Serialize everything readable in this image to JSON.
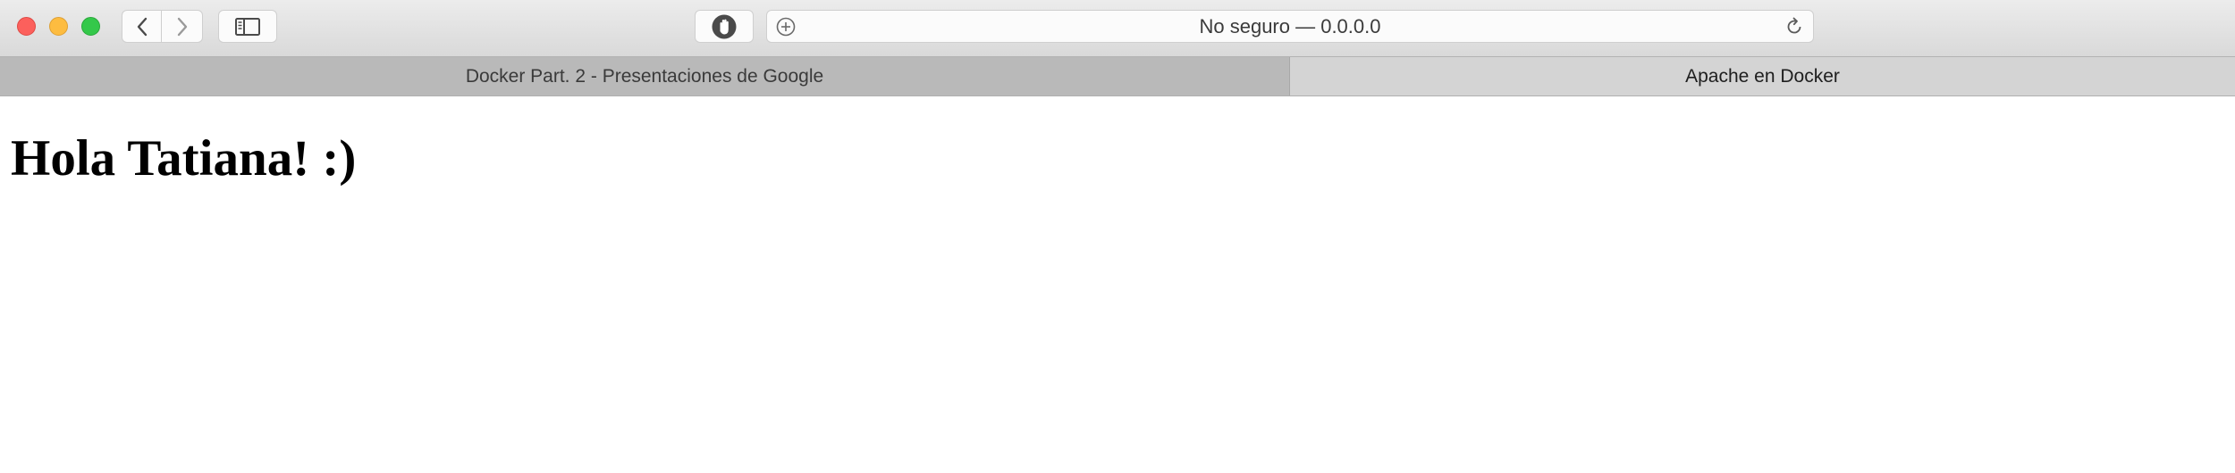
{
  "window": {
    "traffic_lights": {
      "close_color": "#fc605c",
      "minimize_color": "#fdbc40",
      "zoom_color": "#34c84a"
    }
  },
  "toolbar": {
    "icons": {
      "back": "chevron-left-icon",
      "forward": "chevron-right-icon",
      "sidebar": "sidebar-icon",
      "content_blocker": "hand-icon",
      "add": "plus-circle-icon",
      "reload": "reload-icon"
    },
    "address_text": "No seguro — 0.0.0.0"
  },
  "tabs": [
    {
      "label": "Docker Part. 2 - Presentaciones de Google",
      "active": false
    },
    {
      "label": "Apache en Docker",
      "active": true
    }
  ],
  "page": {
    "heading": "Hola Tatiana! :)"
  }
}
